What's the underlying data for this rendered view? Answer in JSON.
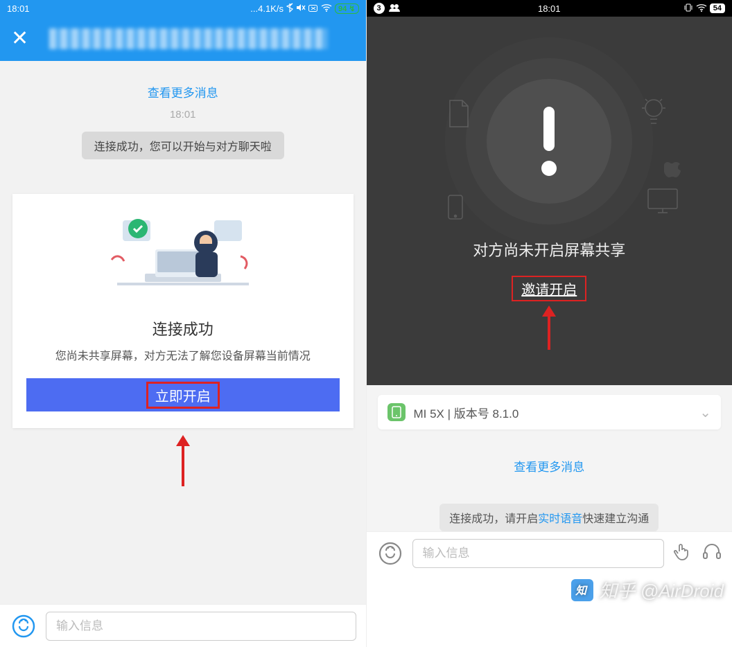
{
  "left": {
    "status_time": "18:01",
    "status_speed": "...4.1K/s",
    "status_battery": "94",
    "more_link": "查看更多消息",
    "timestamp": "18:01",
    "sys_msg": "连接成功，您可以开始与对方聊天啦",
    "card_title": "连接成功",
    "card_sub": "您尚未共享屏幕，对方无法了解您设备屏幕当前情况",
    "card_btn": "立即开启",
    "input_placeholder": "输入信息"
  },
  "right": {
    "status_time": "18:01",
    "status_notif": "3",
    "status_battery": "54",
    "dark_msg": "对方尚未开启屏幕共享",
    "invite_link": "邀请开启",
    "device_name": "MI 5X | 版本号 8.1.0",
    "more_link": "查看更多消息",
    "sys_msg_pre": "连接成功，请开启",
    "sys_msg_link": "实时语音",
    "sys_msg_post": "快速建立沟通",
    "input_placeholder": "输入信息"
  },
  "watermark": "知乎 @AirDroid"
}
